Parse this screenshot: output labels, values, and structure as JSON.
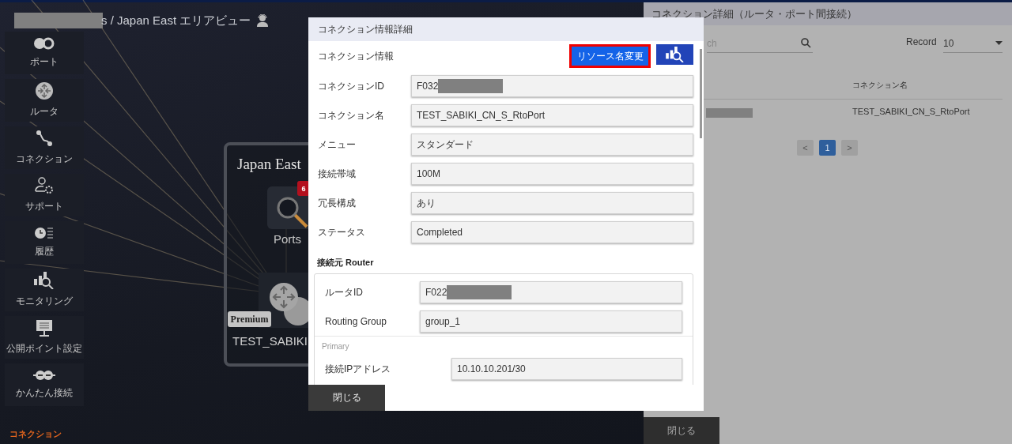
{
  "breadcrumb": {
    "text": "s / Japan East エリアビュー",
    "redacted": true
  },
  "sidebar": {
    "items": [
      {
        "label": "ポート"
      },
      {
        "label": "ルータ"
      },
      {
        "label": "コネクション"
      },
      {
        "label": "サポート"
      },
      {
        "label": "履歴"
      },
      {
        "label": "モニタリング"
      },
      {
        "label": "公開ポイント設定"
      },
      {
        "label": "かんたん接続"
      }
    ],
    "section_label": "コネクション"
  },
  "canvas": {
    "region_title": "Japan East",
    "ports_label": "Ports",
    "ports_badge": "6",
    "router_badge": "Premium",
    "router_label": "TEST_SABIKI"
  },
  "modal": {
    "title": "コネクション情報詳細",
    "section": "コネクション情報",
    "rename_button": "リソース名変更",
    "fields": [
      {
        "label": "コネクションID",
        "value": "F032",
        "redacted": true
      },
      {
        "label": "コネクション名",
        "value": "TEST_SABIKI_CN_S_RtoPort",
        "redacted": false
      },
      {
        "label": "メニュー",
        "value": "スタンダード",
        "redacted": false
      },
      {
        "label": "接続帯域",
        "value": "100M",
        "redacted": false
      },
      {
        "label": "冗長構成",
        "value": "あり",
        "redacted": false
      },
      {
        "label": "ステータス",
        "value": "Completed",
        "redacted": false
      }
    ],
    "router_section": "接続元 Router",
    "router_fields": [
      {
        "label": "ルータID",
        "value": "F022",
        "redacted": true
      },
      {
        "label": "Routing Group",
        "value": "group_1",
        "redacted": false
      }
    ],
    "subsection": "Primary",
    "primary_fields": [
      {
        "label": "接続IPアドレス",
        "value": "10.10.10.201/30",
        "redacted": false
      }
    ],
    "close_button": "閉じる"
  },
  "panel": {
    "title": "コネクション詳細（ルータ・ポート間接続）",
    "search": {
      "placeholder": "ch"
    },
    "record_label": "Record",
    "record_value": "10",
    "table": {
      "columns": [
        "コネクション名"
      ],
      "rows": [
        {
          "id_redacted": true,
          "name": "TEST_SABIKI_CN_S_RtoPort"
        }
      ]
    },
    "pagination": [
      {
        "label": "<",
        "selected": false
      },
      {
        "label": "1",
        "selected": true
      },
      {
        "label": ">",
        "selected": false
      }
    ],
    "close_button": "閉じる"
  }
}
